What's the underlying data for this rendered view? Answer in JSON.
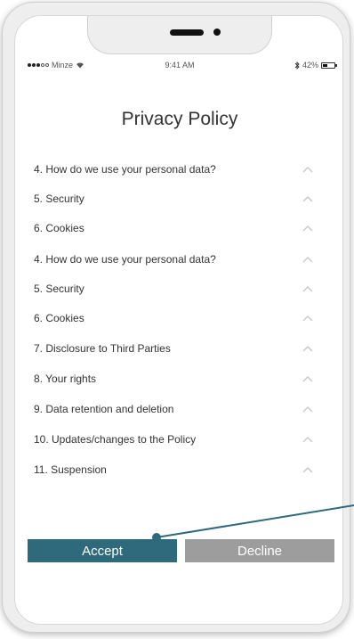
{
  "status_bar": {
    "carrier": "Minze",
    "time": "9:41 AM",
    "battery_percent": "42%",
    "battery_level": 0.42
  },
  "page": {
    "title": "Privacy Policy"
  },
  "policy_items": [
    {
      "label": "4. How do we use your personal data?"
    },
    {
      "label": "5. Security"
    },
    {
      "label": "6. Cookies"
    },
    {
      "label": "4. How do we use your personal data?"
    },
    {
      "label": "5. Security"
    },
    {
      "label": "6. Cookies"
    },
    {
      "label": "7. Disclosure to Third Parties"
    },
    {
      "label": "8. Your rights"
    },
    {
      "label": "9. Data retention and deletion"
    },
    {
      "label": "10. Updates/changes to the Policy"
    },
    {
      "label": "11. Suspension"
    }
  ],
  "buttons": {
    "accept_label": "Accept",
    "decline_label": "Decline"
  },
  "colors": {
    "accent": "#2e6a7b",
    "decline": "#9d9d9d",
    "text": "#333333",
    "chevron": "#c8c8c8"
  }
}
